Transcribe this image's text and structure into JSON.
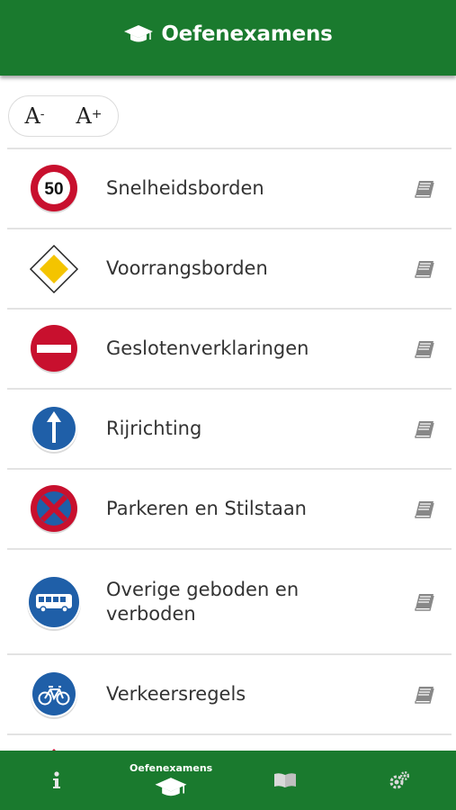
{
  "header": {
    "title": "Oefenexamens",
    "icon": "graduation-cap-icon"
  },
  "font_controls": {
    "decrease": {
      "letter": "A",
      "sign": "-"
    },
    "increase": {
      "letter": "A",
      "sign": "+"
    }
  },
  "items": [
    {
      "label": "Snelheidsborden",
      "sign": "speed-limit-50-sign",
      "sign_text": "50"
    },
    {
      "label": "Voorrangsborden",
      "sign": "priority-road-sign"
    },
    {
      "label": "Geslotenverklaringen",
      "sign": "no-entry-sign"
    },
    {
      "label": "Rijrichting",
      "sign": "one-way-arrow-sign"
    },
    {
      "label": "Parkeren en Stilstaan",
      "sign": "no-stopping-sign"
    },
    {
      "label": "Overige geboden en verboden",
      "sign": "bus-lane-sign"
    },
    {
      "label": "Verkeersregels",
      "sign": "bicycle-path-sign"
    }
  ],
  "tabbar": {
    "tabs": [
      {
        "name": "info",
        "icon": "info-icon",
        "label": ""
      },
      {
        "name": "oefenexamens",
        "icon": "graduation-cap-icon",
        "label": "Oefenexamens",
        "active": true
      },
      {
        "name": "theory",
        "icon": "open-book-icon",
        "label": ""
      },
      {
        "name": "settings",
        "icon": "gears-icon",
        "label": ""
      }
    ]
  },
  "colors": {
    "brand_green": "#1a7a2e",
    "sign_red": "#c8102e",
    "sign_blue": "#1f5fa8"
  }
}
